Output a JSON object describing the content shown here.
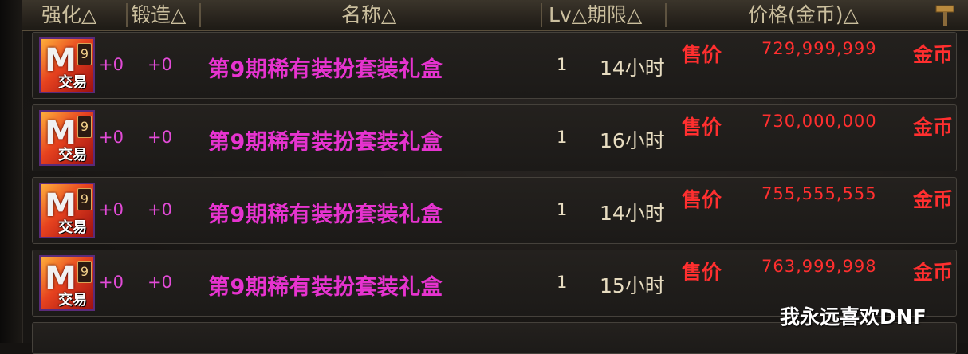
{
  "header": {
    "col_enhance": "强化△",
    "col_forge": "锻造△",
    "col_name": "名称△",
    "col_lv_period": "Lv△期限△",
    "col_price": "价格(金币)△"
  },
  "icon": {
    "level": "9",
    "glyph": "M",
    "trade_label": "交易"
  },
  "rows": [
    {
      "enhance": "+0",
      "forge": "+0",
      "name": "第9期稀有装扮套装礼盒",
      "lv": "1",
      "period": "14小时",
      "sell_label": "售价",
      "price": "729,999,999",
      "currency": "金币"
    },
    {
      "enhance": "+0",
      "forge": "+0",
      "name": "第9期稀有装扮套装礼盒",
      "lv": "1",
      "period": "16小时",
      "sell_label": "售价",
      "price": "730,000,000",
      "currency": "金币"
    },
    {
      "enhance": "+0",
      "forge": "+0",
      "name": "第9期稀有装扮套装礼盒",
      "lv": "1",
      "period": "14小时",
      "sell_label": "售价",
      "price": "755,555,555",
      "currency": "金币"
    },
    {
      "enhance": "+0",
      "forge": "+0",
      "name": "第9期稀有装扮套装礼盒",
      "lv": "1",
      "period": "15小时",
      "sell_label": "售价",
      "price": "763,999,998",
      "currency": "金币"
    }
  ],
  "watermark": "我永远喜欢DNF",
  "colors": {
    "item_name": "#e633cf",
    "price": "#ff2f2f",
    "header_text": "#cbbf9e"
  },
  "icons": {
    "sort_tool": "hammer-icon",
    "item": "costume-box-icon"
  }
}
